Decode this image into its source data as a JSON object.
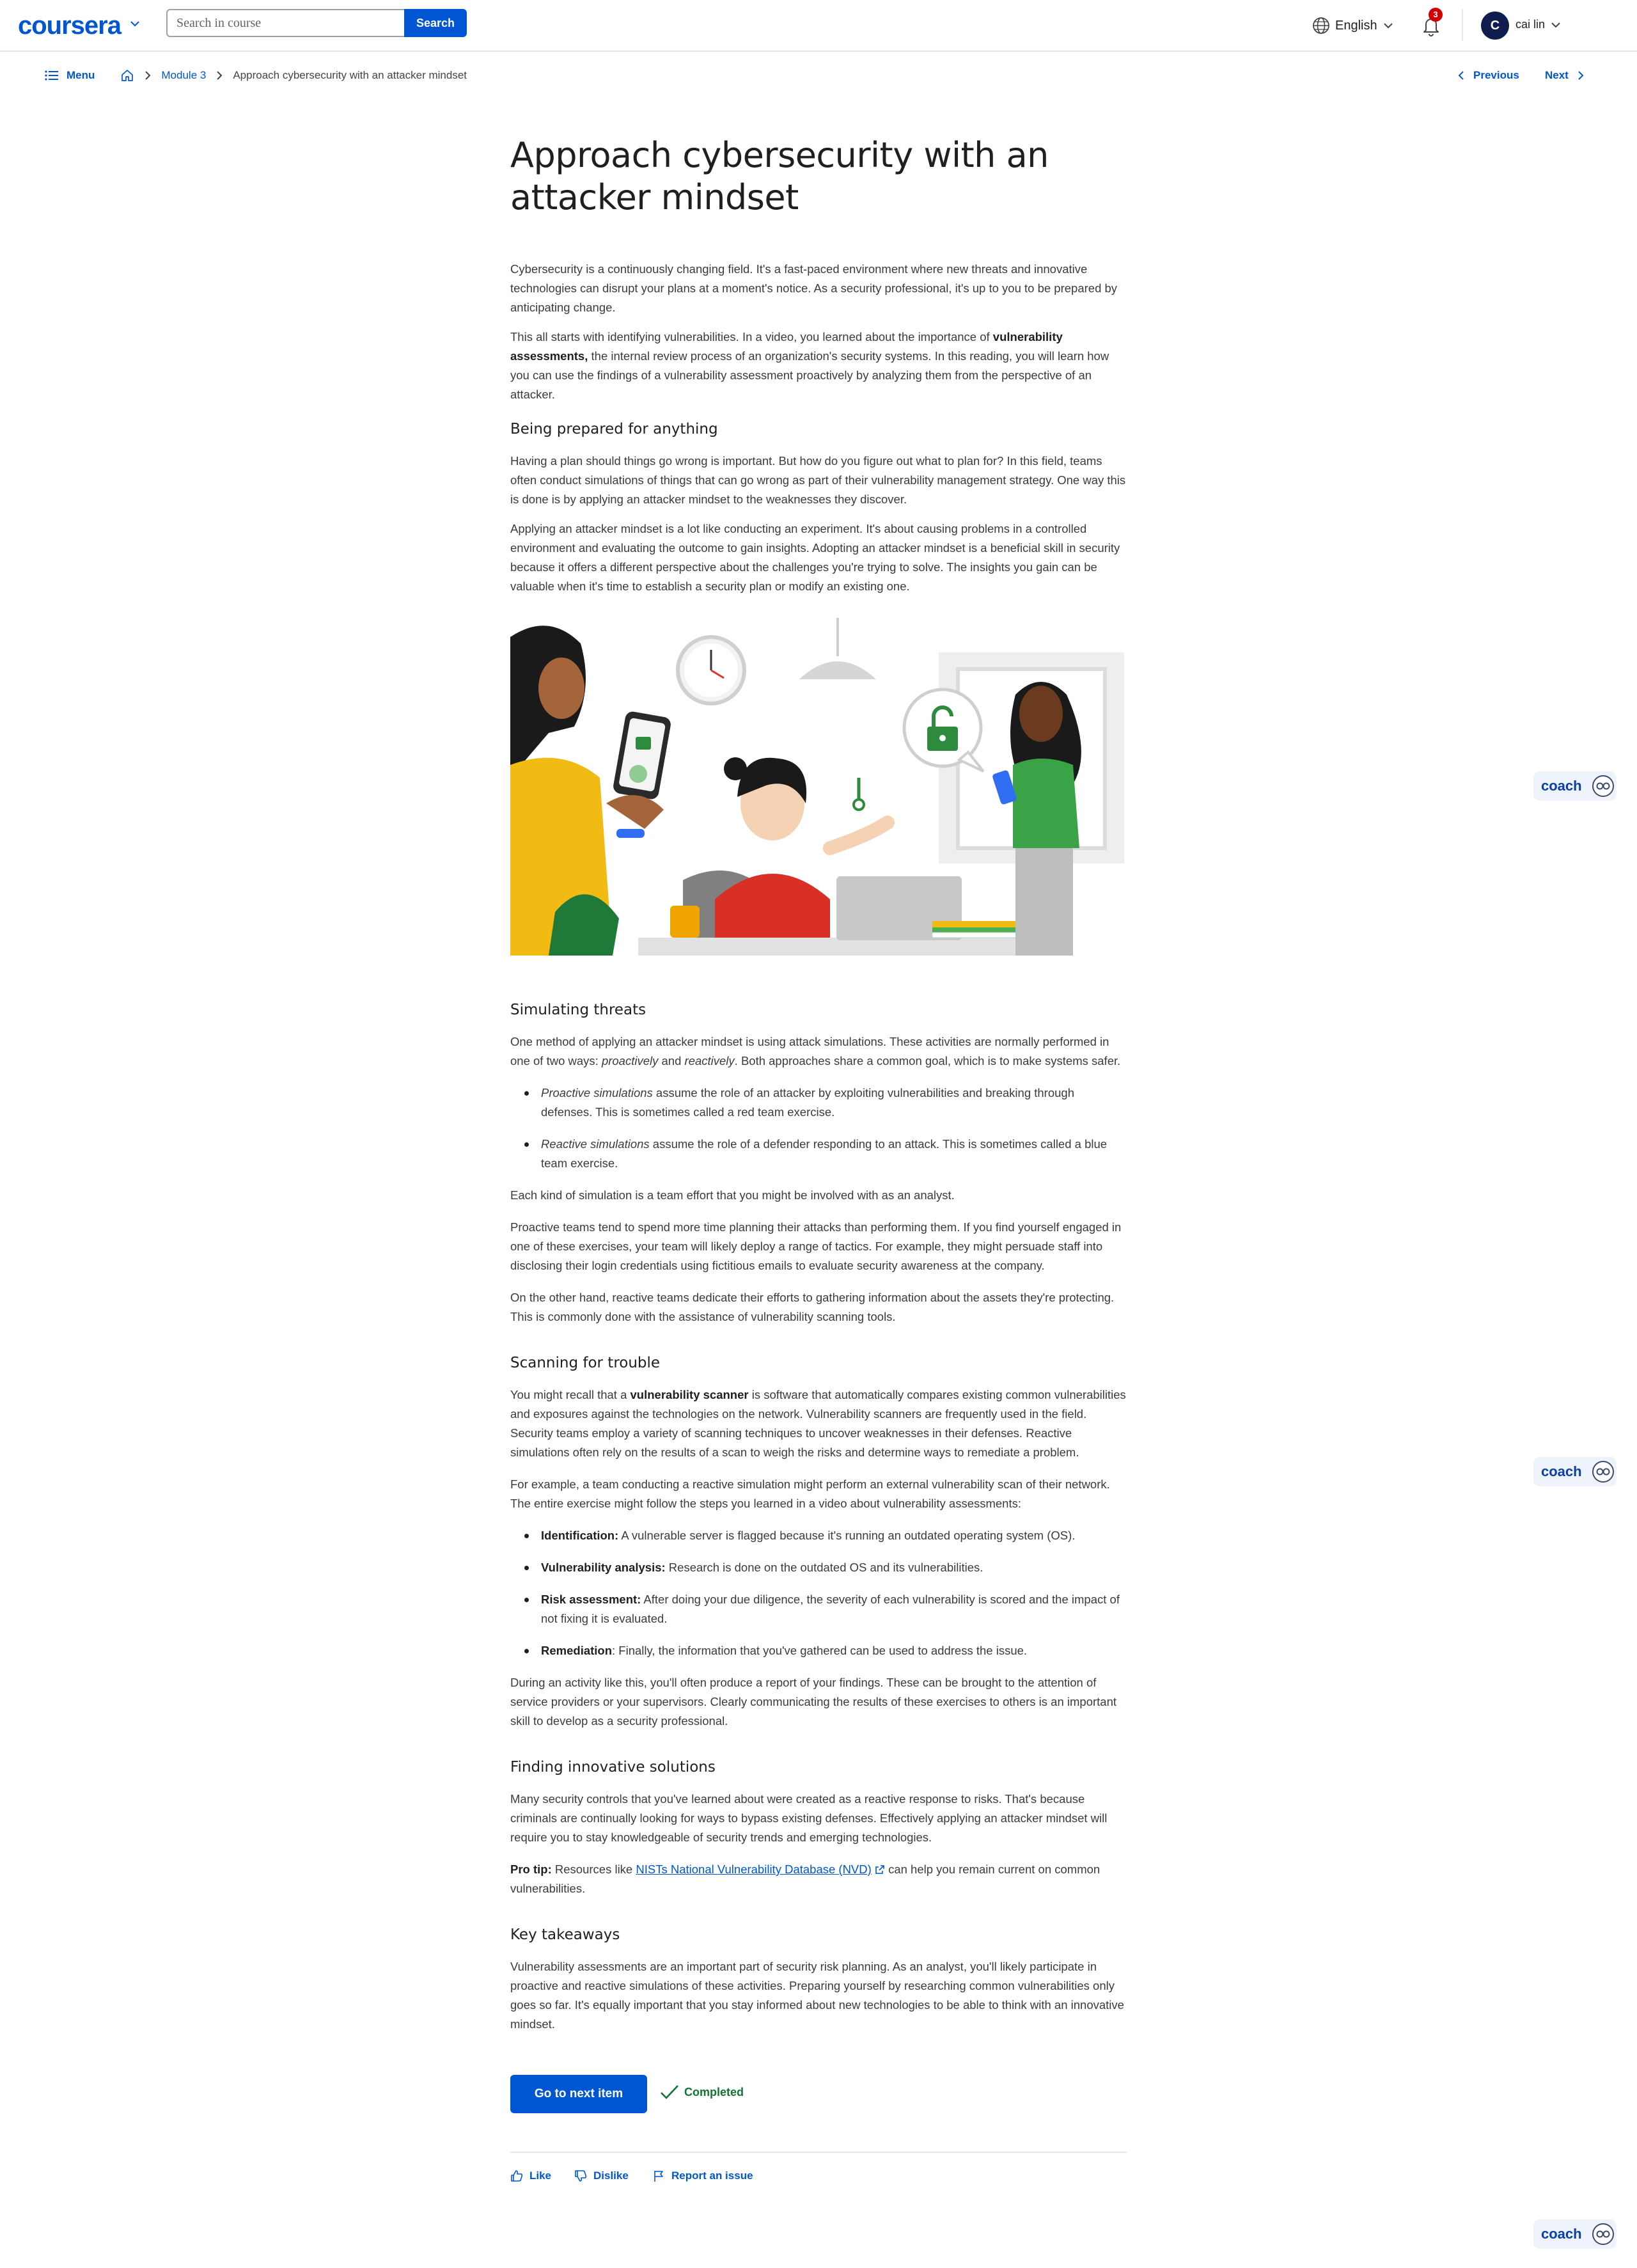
{
  "header": {
    "logo": "coursera",
    "search_placeholder": "Search in course",
    "search_button": "Search",
    "language": "English",
    "notification_count": "3",
    "avatar_initial": "C",
    "user_name": "cai lin"
  },
  "breadcrumb": {
    "menu_label": "Menu",
    "module": "Module 3",
    "current": "Approach cybersecurity with an attacker mindset",
    "previous": "Previous",
    "next": "Next"
  },
  "article": {
    "title": "Approach cybersecurity with an attacker mindset",
    "intro_p1": "Cybersecurity is a continuously changing field. It's a fast-paced environment where new threats and innovative technologies can disrupt your plans at a moment's notice. As a security professional, it's up to you to be prepared by anticipating change.",
    "intro_p2_a": "This all starts with identifying vulnerabilities. In a video, you learned about the importance of ",
    "intro_p2_bold": "vulnerability assessments,",
    "intro_p2_b": " the internal review process of an organization's security systems. In this reading, you will learn how you can use the findings of a vulnerability assessment proactively by analyzing them from the perspective of an attacker.",
    "h_prepared": "Being prepared for anything",
    "prepared_p1": "Having a plan should things go wrong is important. But how do you figure out what to plan for? In this field, teams often conduct simulations of things that can go wrong as part of their vulnerability management strategy. One way this is done is by applying an attacker mindset to the weaknesses they discover.",
    "prepared_p2": "Applying an attacker mindset is a lot like conducting an experiment. It's about causing problems in a controlled environment and evaluating the outcome to gain insights. Adopting an attacker mindset is a beneficial skill in security because it offers a different perspective about the challenges you're trying to solve. The insights you gain can be valuable when it's time to establish a security plan or modify an existing one.",
    "h_simulating": "Simulating threats",
    "sim_p1_a": "One method of applying an attacker mindset is using attack simulations. These activities are normally performed in one of two ways: ",
    "sim_p1_i1": "proactively",
    "sim_p1_and": " and ",
    "sim_p1_i2": "reactively",
    "sim_p1_b": ". Both approaches share a common goal, which is to make systems safer.",
    "sim_li1_i": "Proactive simulations",
    "sim_li1": " assume the role of an attacker by exploiting vulnerabilities and breaking through defenses. This is sometimes called a red team exercise.",
    "sim_li2_i": "Reactive simulations",
    "sim_li2": " assume the role of a defender responding to an attack. This is sometimes called a blue team exercise.",
    "sim_p2": "Each kind of simulation is a team effort that you might be involved with as an analyst.",
    "sim_p3": "Proactive teams tend to spend more time planning their attacks than performing them. If you find yourself engaged in one of these exercises, your team will likely deploy a range of tactics. For example, they might persuade staff into disclosing their login credentials using fictitious emails to evaluate security awareness at the company.",
    "sim_p4": "On the other hand, reactive teams dedicate their efforts to gathering information about the assets they're protecting. This is commonly done with the assistance of vulnerability scanning tools.",
    "h_scanning": "Scanning for trouble",
    "scan_p1_a": "You might recall that a ",
    "scan_p1_bold": "vulnerability scanner",
    "scan_p1_b": " is software that automatically compares existing common vulnerabilities and exposures against the technologies on the network. Vulnerability scanners are frequently used in the field. Security teams employ a variety of scanning techniques to uncover weaknesses in their defenses. Reactive simulations often rely on the results of a scan to weigh the risks and determine ways to remediate a problem.",
    "scan_p2": "For example, a team conducting a reactive simulation might perform an external vulnerability scan of their network. The entire exercise might follow the steps you learned in a video about vulnerability assessments:",
    "steps": [
      {
        "term": "Identification:",
        "text": " A vulnerable server is flagged because it's running an outdated operating system (OS)."
      },
      {
        "term": "Vulnerability analysis:",
        "text": " Research is done on the outdated OS and its vulnerabilities."
      },
      {
        "term": "Risk assessment:",
        "text": " After doing your due diligence, the severity of each vulnerability is scored and the impact of not fixing it is evaluated."
      },
      {
        "term": "Remediation",
        "text": ": Finally, the information that you've gathered can be used to address the issue."
      }
    ],
    "scan_p3": "During an activity like this, you'll often produce a report of your findings. These can be brought to the attention of service providers or your supervisors. Clearly communicating the results of these exercises to others is an important skill to develop as a security professional.",
    "h_innovative": "Finding innovative solutions",
    "innov_p1": "Many security controls that you've learned about were created as a reactive response to risks. That's because criminals are continually looking for ways to bypass existing defenses. Effectively applying an attacker mindset will require you to stay knowledgeable of security trends and emerging technologies.",
    "protip_label": "Pro tip:",
    "protip_a": " Resources like ",
    "protip_link": "NISTs National Vulnerability Database (NVD)",
    "protip_b": " can help you remain current on common vulnerabilities.",
    "h_takeaways": "Key takeaways",
    "takeaways_p": "Vulnerability assessments are an important part of security risk planning. As an analyst, you'll likely participate in proactive and reactive simulations of these activities. Preparing yourself by researching common vulnerabilities only goes so far. It's equally important that you stay informed about new technologies to be able to think with an innovative mindset."
  },
  "actions": {
    "next_item": "Go to next item",
    "completed": "Completed",
    "like": "Like",
    "dislike": "Dislike",
    "report": "Report an issue"
  },
  "coach_label": "coach",
  "colors": {
    "brand": "#0056d2",
    "success": "#137333",
    "alert": "#d30001"
  }
}
